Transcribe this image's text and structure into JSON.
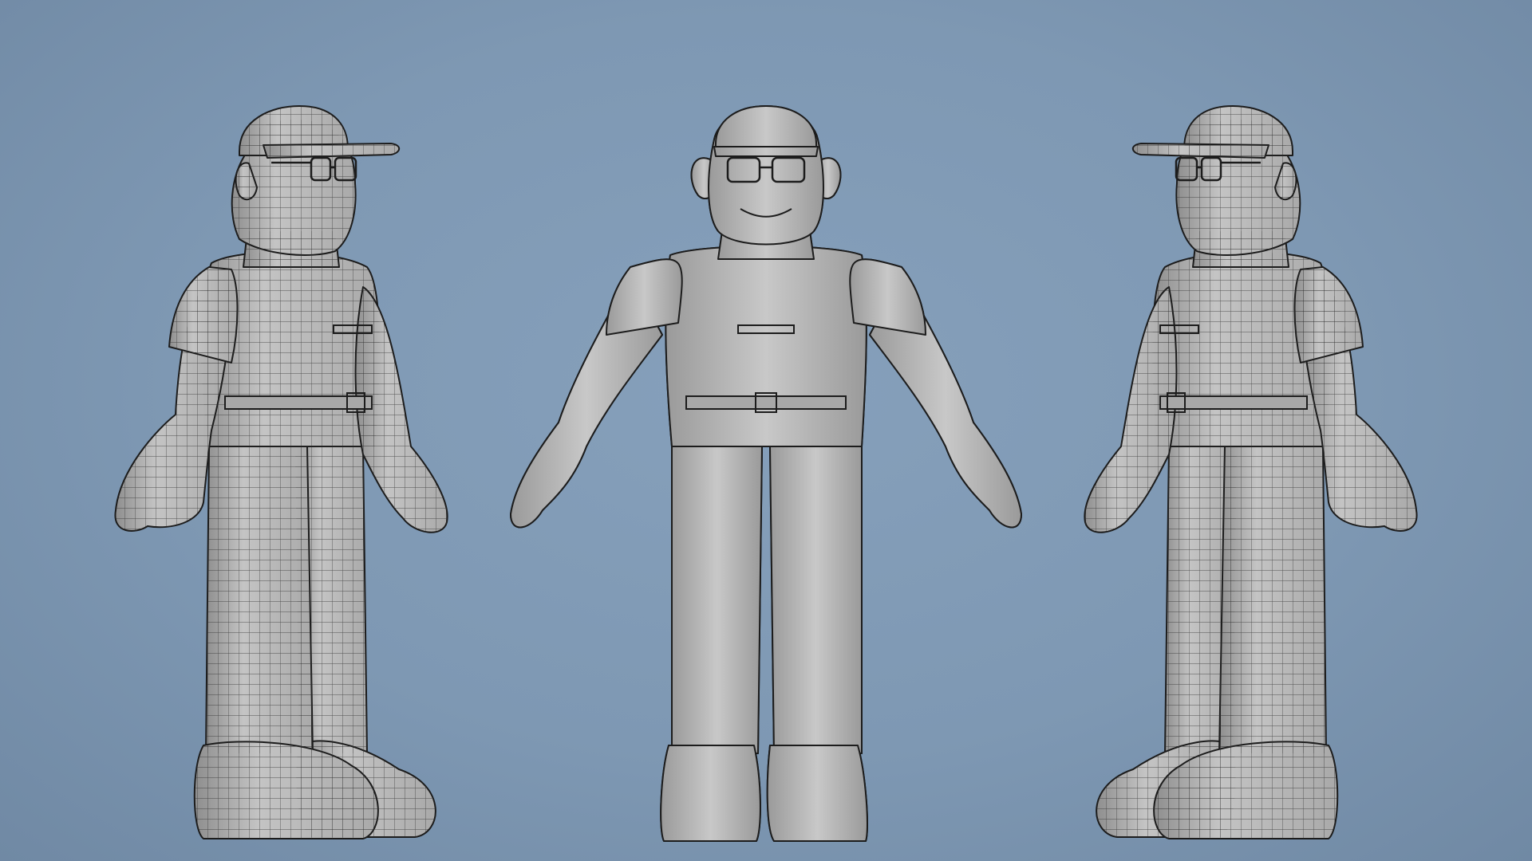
{
  "scene": {
    "views": [
      {
        "name": "three-quarter-left",
        "subject": "character-model"
      },
      {
        "name": "front",
        "subject": "character-model"
      },
      {
        "name": "three-quarter-right",
        "subject": "character-model"
      }
    ],
    "colors": {
      "background": "#7e98b3",
      "surface": "#b9b9b9",
      "surface_dark": "#8e8e8e",
      "wire": "#2b2b2b",
      "outline": "#1c1c1c"
    }
  }
}
